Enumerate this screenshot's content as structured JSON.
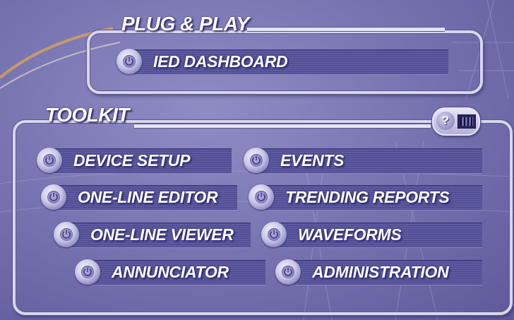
{
  "plug_play": {
    "heading": "PLUG & PLAY",
    "buttons": [
      {
        "label": "IED DASHBOARD"
      }
    ]
  },
  "toolkit": {
    "heading": "TOOLKIT",
    "help_icon": "question-film-icon",
    "buttons": [
      {
        "label": "DEVICE SETUP"
      },
      {
        "label": "EVENTS"
      },
      {
        "label": "ONE-LINE EDITOR"
      },
      {
        "label": "TRENDING REPORTS"
      },
      {
        "label": "ONE-LINE VIEWER"
      },
      {
        "label": "WAVEFORMS"
      },
      {
        "label": "ANNUNCIATOR"
      },
      {
        "label": "ADMINISTRATION"
      }
    ]
  },
  "help": {
    "symbol": "?"
  },
  "colors": {
    "background": "#7f7bb7",
    "frame": "#d8d6ec",
    "bar": "#4d4a8f",
    "text": "#ffffff"
  }
}
